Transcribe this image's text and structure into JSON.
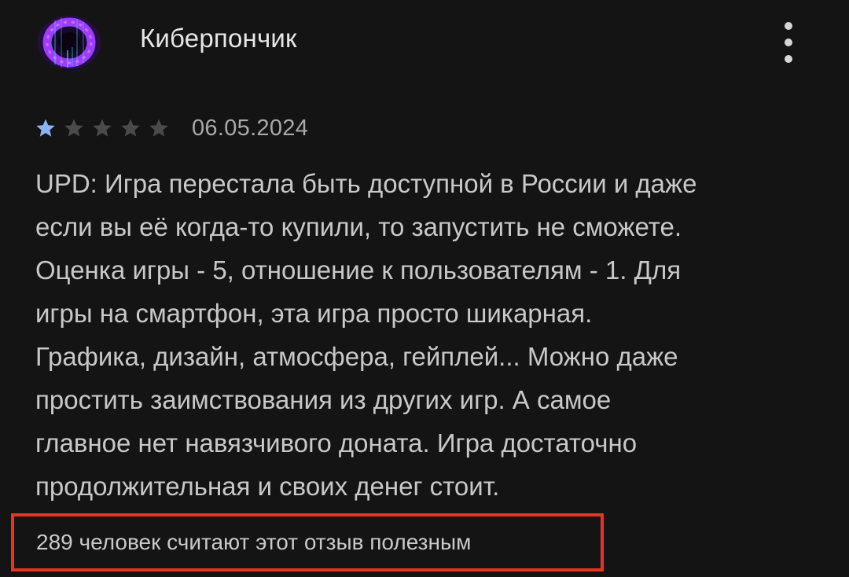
{
  "review": {
    "author": {
      "name": "Киберпончик",
      "avatar_icon": "avatar-icon"
    },
    "menu_icon": "more-vert-icon",
    "rating": {
      "stars": 1,
      "max_stars": 5,
      "filled_color": "#8ab4f8",
      "empty_color": "#4a4a4a"
    },
    "date": "06.05.2024",
    "text": "UPD: Игра перестала быть доступной в России и даже\nесли вы её когда-то купили, то запустить не сможете.\nОценка игры - 5, отношение к пользователям - 1. Для\nигры на смартфон, эта игра просто шикарная.\nГрафика, дизайн, атмосфера, гейплей... Можно даже\nпростить заимствования из других игр. А самое\nглавное нет навязчивого доната. Игра достаточно\nпродолжительная и своих денег стоит.",
    "helpful": "289 человек считают этот отзыв полезным",
    "highlight_color": "#e8341c"
  }
}
